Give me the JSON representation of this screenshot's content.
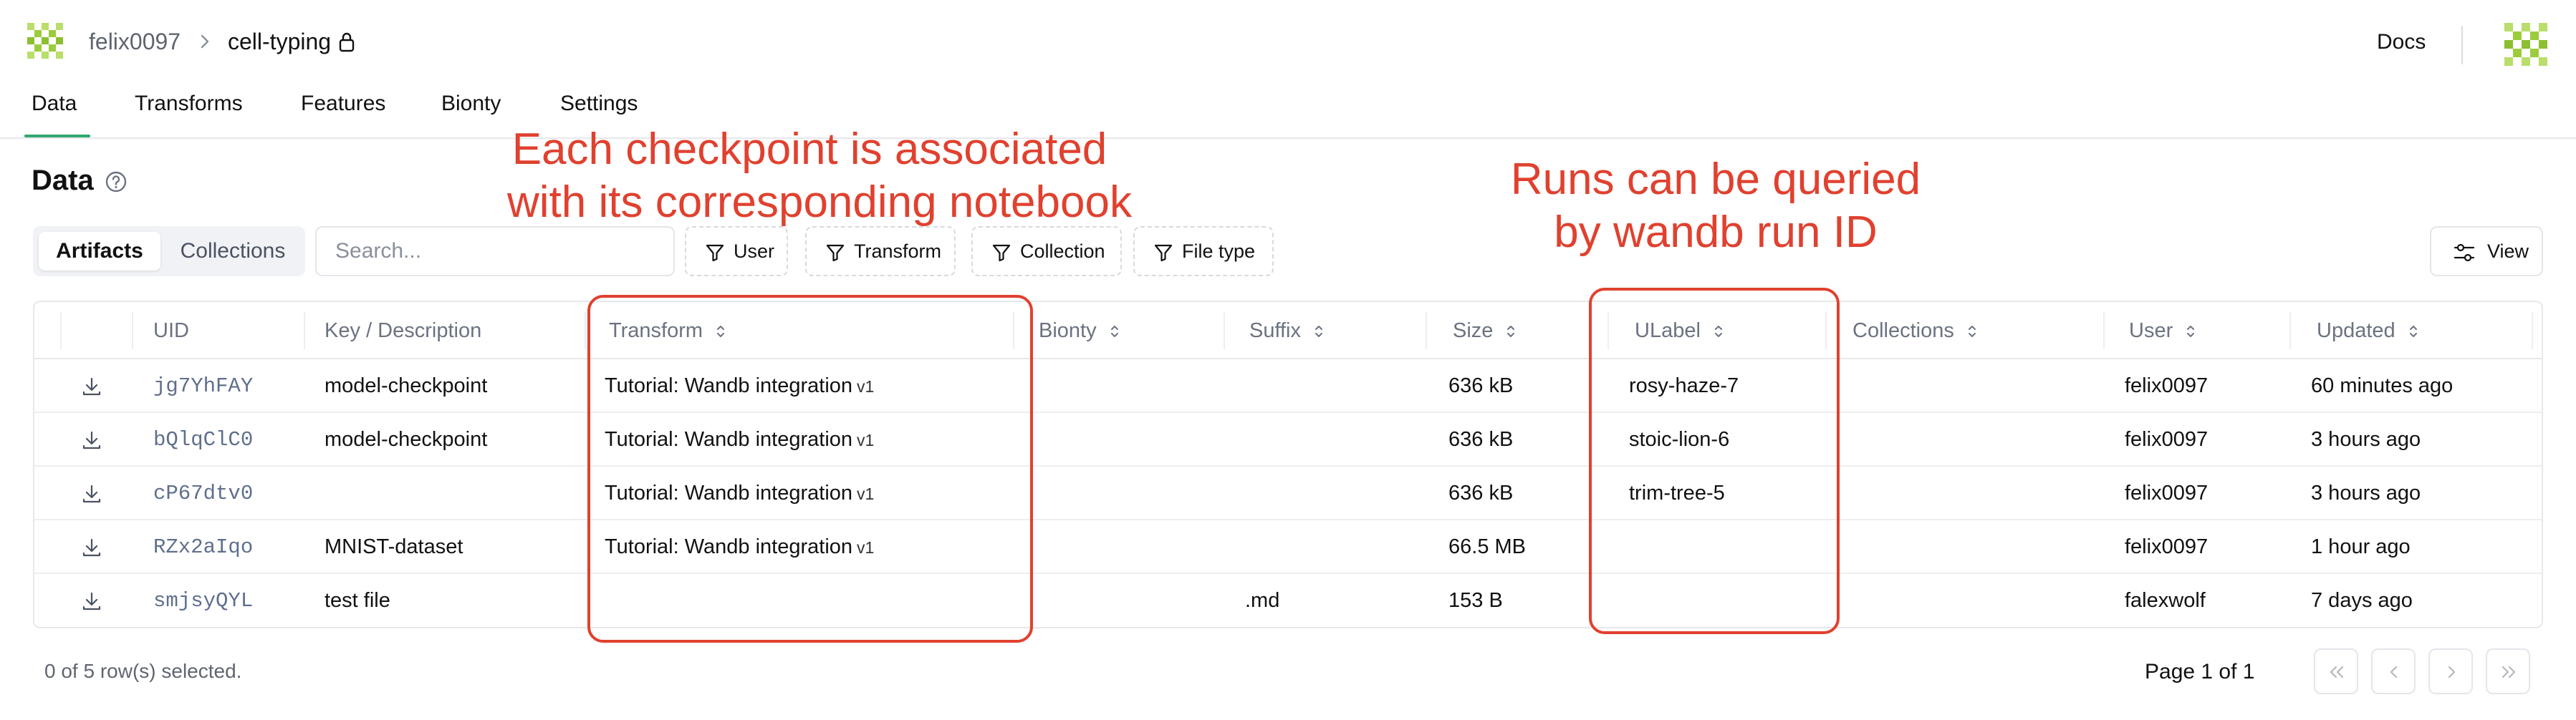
{
  "header": {
    "owner": "felix0097",
    "repo": "cell-typing",
    "docs_label": "Docs"
  },
  "tabs": [
    {
      "label": "Data",
      "active": true
    },
    {
      "label": "Transforms"
    },
    {
      "label": "Features"
    },
    {
      "label": "Bionty"
    },
    {
      "label": "Settings"
    }
  ],
  "page": {
    "title": "Data"
  },
  "toolbar": {
    "segments": [
      "Artifacts",
      "Collections"
    ],
    "active_segment": "Artifacts",
    "search_placeholder": "Search...",
    "filters": [
      "User",
      "Transform",
      "Collection",
      "File type"
    ],
    "view_label": "View"
  },
  "table": {
    "columns": [
      "UID",
      "Key / Description",
      "Transform",
      "Bionty",
      "Suffix",
      "Size",
      "ULabel",
      "Collections",
      "User",
      "Updated"
    ],
    "rows": [
      {
        "uid": "jg7YhFAY",
        "key": "model-checkpoint",
        "transform": "Tutorial: Wandb integration",
        "transform_version": "v1",
        "bionty": "",
        "suffix": "",
        "size": "636 kB",
        "ulabel": "rosy-haze-7",
        "collections": "",
        "user": "felix0097",
        "updated": "60 minutes ago"
      },
      {
        "uid": "bQlqClC0",
        "key": "model-checkpoint",
        "transform": "Tutorial: Wandb integration",
        "transform_version": "v1",
        "bionty": "",
        "suffix": "",
        "size": "636 kB",
        "ulabel": "stoic-lion-6",
        "collections": "",
        "user": "felix0097",
        "updated": "3 hours ago"
      },
      {
        "uid": "cP67dtv0",
        "key": "",
        "transform": "Tutorial: Wandb integration",
        "transform_version": "v1",
        "bionty": "",
        "suffix": "",
        "size": "636 kB",
        "ulabel": "trim-tree-5",
        "collections": "",
        "user": "felix0097",
        "updated": "3 hours ago"
      },
      {
        "uid": "RZx2aIqo",
        "key": "MNIST-dataset",
        "transform": "Tutorial: Wandb integration",
        "transform_version": "v1",
        "bionty": "",
        "suffix": "",
        "size": "66.5 MB",
        "ulabel": "",
        "collections": "",
        "user": "felix0097",
        "updated": "1 hour ago"
      },
      {
        "uid": "smjsyQYL",
        "key": "test file",
        "transform": "",
        "transform_version": "",
        "bionty": "",
        "suffix": ".md",
        "size": "153 B",
        "ulabel": "",
        "collections": "",
        "user": "falexwolf",
        "updated": "7 days ago"
      }
    ]
  },
  "footer": {
    "selection": "0 of 5 row(s) selected.",
    "page_info": "Page 1 of 1"
  },
  "annotations": {
    "transform_note_line1": "Each checkpoint is associated",
    "transform_note_line2": "with its corresponding notebook",
    "ulabel_note_line1": "Runs can be queried",
    "ulabel_note_line2": "by wandb run ID",
    "color": "#e0412f"
  },
  "colors": {
    "brand": "#9ccc3c",
    "tab_active_underline": "#2fa76f",
    "uid_text": "#5f6f8c"
  },
  "icons": {
    "logo": "lamin-logo-icon",
    "lock": "lock-icon",
    "help": "help-circle-icon",
    "filter": "filter-icon",
    "view": "sliders-icon",
    "download": "download-icon"
  }
}
